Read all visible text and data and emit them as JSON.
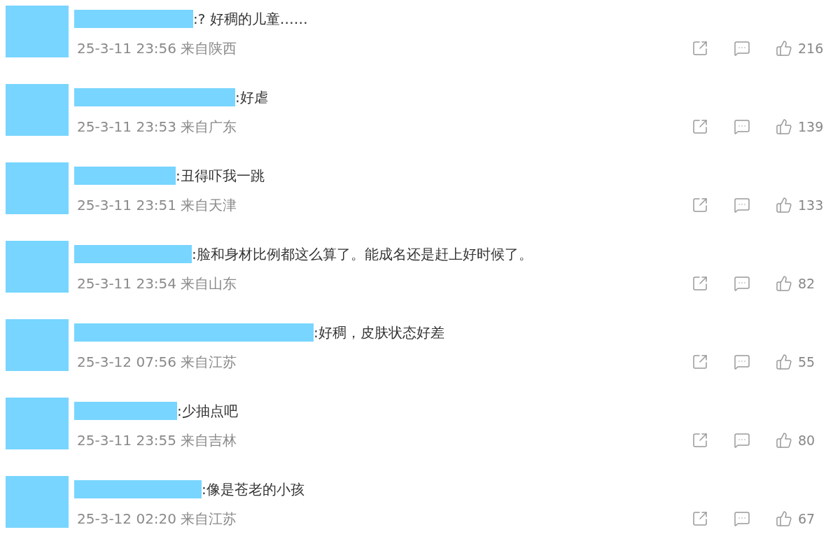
{
  "comments": [
    {
      "text": ":? 好稠的儿童……",
      "meta": "25-3-11 23:56 来自陕西",
      "likes": "216"
    },
    {
      "text": ":好虐",
      "meta": "25-3-11 23:53 来自广东",
      "likes": "139"
    },
    {
      "text": ":丑得吓我一跳",
      "meta": "25-3-11 23:51 来自天津",
      "likes": "133"
    },
    {
      "text": ":脸和身材比例都这么算了。能成名还是赶上好时候了。",
      "meta": "25-3-11 23:54 来自山东",
      "likes": "82"
    },
    {
      "text": ":好稠，皮肤状态好差",
      "meta": "25-3-12 07:56 来自江苏",
      "likes": "55"
    },
    {
      "text": ":少抽点吧",
      "meta": "25-3-11 23:55 来自吉林",
      "likes": "80"
    },
    {
      "text": ":像是苍老的小孩",
      "meta": "25-3-12 02:20 来自江苏",
      "likes": "67"
    }
  ]
}
